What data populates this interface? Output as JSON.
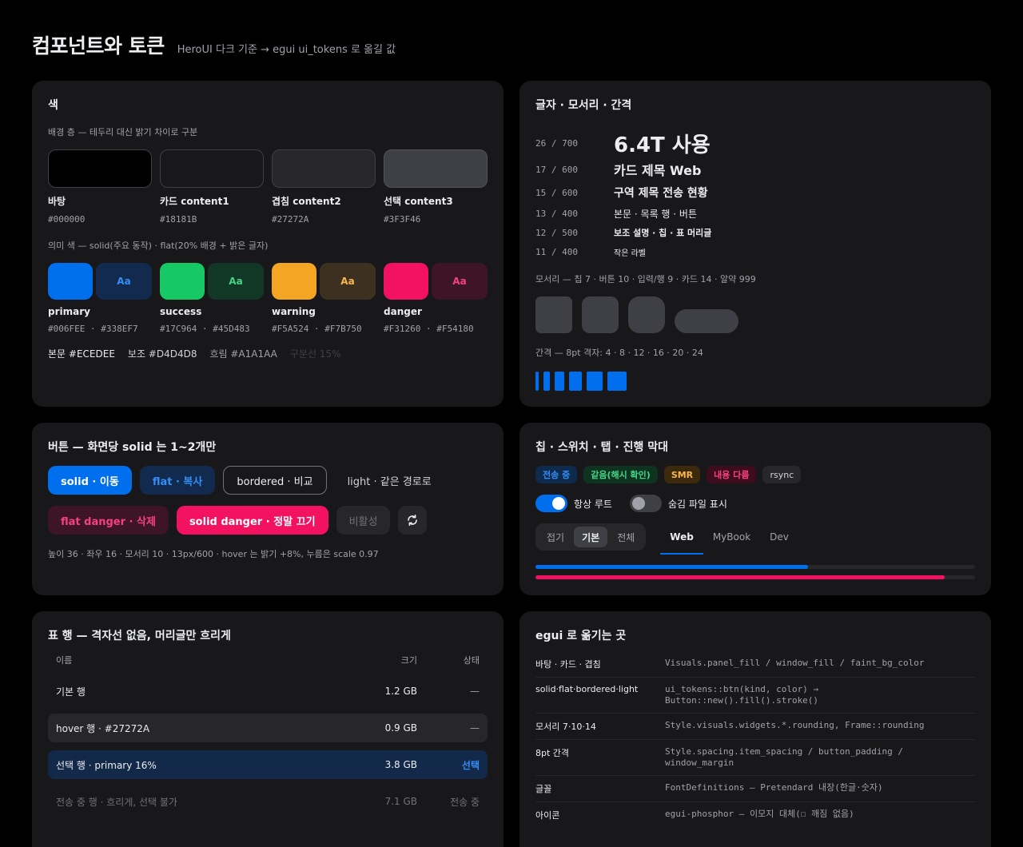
{
  "header": {
    "title": "컴포넌트와 토큰",
    "subtitle": "HeroUI 다크 기준 → egui ui_tokens 로 옮길 값"
  },
  "colors_card": {
    "title": "색",
    "surface_caption": "배경 층 — 테두리 대신 밝기 차이로 구분",
    "surfaces": [
      {
        "name": "바탕",
        "hex": "#000000"
      },
      {
        "name": "카드 content1",
        "hex": "#18181B"
      },
      {
        "name": "겹침 content2",
        "hex": "#27272A"
      },
      {
        "name": "선택 content3",
        "hex": "#3F3F46"
      }
    ],
    "semantic_caption": "의미 색 — solid(주요 동작) · flat(20% 배경 + 밝은 글자)",
    "flat_label": "Aa",
    "semantics": [
      {
        "name": "primary",
        "solid": "#006FEE",
        "flat_text": "#338EF7",
        "hexes": "#006FEE  ·  #338EF7"
      },
      {
        "name": "success",
        "solid": "#17C964",
        "flat_text": "#45D483",
        "hexes": "#17C964  ·  #45D483"
      },
      {
        "name": "warning",
        "solid": "#F5A524",
        "flat_text": "#F7B750",
        "hexes": "#F5A524  ·  #F7B750"
      },
      {
        "name": "danger",
        "solid": "#F31260",
        "flat_text": "#F54180",
        "hexes": "#F31260  ·  #F54180"
      }
    ],
    "text_tokens": [
      "본문 #ECEDEE",
      "보조 #D4D4D8",
      "흐림 #A1A1AA",
      "구분선 15%"
    ]
  },
  "type_card": {
    "title": "글자 · 모서리 · 간격",
    "rows": [
      {
        "spec": "26 / 700",
        "sample": "6.4T 사용"
      },
      {
        "spec": "17 / 600",
        "sample": "카드 제목 Web"
      },
      {
        "spec": "15 / 600",
        "sample": "구역 제목 전송 현황"
      },
      {
        "spec": "13 / 400",
        "sample": "본문 · 목록 행 · 버튼"
      },
      {
        "spec": "12 / 500",
        "sample": "보조 설명 · 칩 · 표 머리글"
      },
      {
        "spec": "11 / 400",
        "sample": "작은 라벨"
      }
    ],
    "radius_caption": "모서리 — 칩 7 · 버튼 10 · 입력/행 9 · 카드 14 · 알약 999",
    "spacing_caption": "간격 — 8pt 격자: 4 · 8 · 12 · 16 · 20 · 24"
  },
  "buttons_card": {
    "title": "버튼 — 화면당 solid 는 1~2개만",
    "solid": "solid · 이동",
    "flat": "flat · 복사",
    "bordered": "bordered · 비교",
    "light": "light · 같은 경로로",
    "flat_danger": "flat danger · 삭제",
    "solid_danger": "solid danger · 정말 끄기",
    "disabled": "비활성",
    "caption": "높이 36 · 좌우 16 · 모서리 10 · 13px/600 · hover 는 밝기 +8%, 누름은 scale 0.97"
  },
  "chips_card": {
    "title": "칩 · 스위치 · 탭 · 진행 막대",
    "chips": [
      {
        "label": "전송 중",
        "bg": "#0E2A4D",
        "fg": "#338EF7"
      },
      {
        "label": "같음(해시 확인)",
        "bg": "#0F3321",
        "fg": "#45D483"
      },
      {
        "label": "SMR",
        "bg": "#3D2A0C",
        "fg": "#F7B750"
      },
      {
        "label": "내용 다름",
        "bg": "#3D0C1D",
        "fg": "#F54180"
      },
      {
        "label": "rsync",
        "bg": "#27272A",
        "fg": "#D4D4D8"
      }
    ],
    "switch_on": "항상 루트",
    "switch_off": "숨김 파일 표시",
    "segments": [
      "접기",
      "기본",
      "전체"
    ],
    "segment_selected": "기본",
    "tabs": [
      "Web",
      "MyBook",
      "Dev"
    ],
    "tab_selected": "Web",
    "progress": [
      0.62,
      0.93
    ]
  },
  "table_card": {
    "title": "표 행 — 격자선 없음, 머리글만 흐리게",
    "headers": {
      "name": "이름",
      "size": "크기",
      "state": "상태"
    },
    "rows": [
      {
        "name": "기본 행",
        "size": "1.2 GB",
        "state": "—"
      },
      {
        "name": "hover 행 · #27272A",
        "size": "0.9 GB",
        "state": "—"
      },
      {
        "name": "선택 행 · primary 16%",
        "size": "3.8 GB",
        "state": "선택"
      },
      {
        "name": "전송 중 행 · 흐리게, 선택 불가",
        "size": "7.1 GB",
        "state": "전송 중"
      }
    ]
  },
  "egui_card": {
    "title": "egui 로 옮기는 곳",
    "rows": [
      {
        "k": "바탕 · 카드 · 겹침",
        "v": "Visuals.panel_fill / window_fill / faint_bg_color"
      },
      {
        "k": "solid·flat·bordered·light",
        "v": "ui_tokens::btn(kind, color) →\nButton::new().fill().stroke()"
      },
      {
        "k": "모서리 7·10·14",
        "v": "Style.visuals.widgets.*.rounding, Frame::rounding"
      },
      {
        "k": "8pt 간격",
        "v": "Style.spacing.item_spacing / button_padding /\nwindow_margin"
      },
      {
        "k": "글꼴",
        "v": "FontDefinitions — Pretendard 내장(한글·숫자)"
      },
      {
        "k": "아이콘",
        "v": "egui-phosphor — 이모지 대체(☐ 깨짐 없음)"
      }
    ]
  }
}
